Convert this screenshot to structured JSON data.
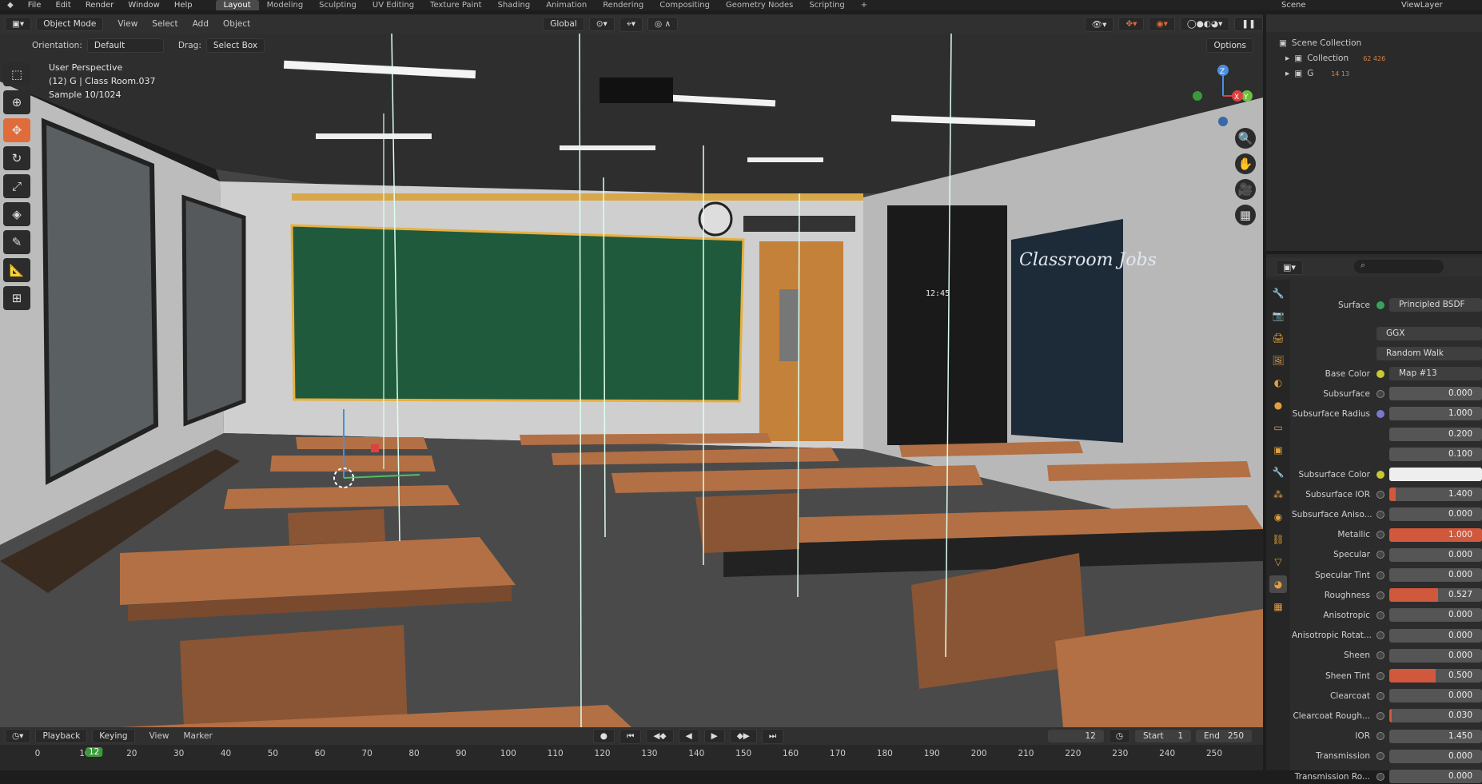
{
  "topbar": {
    "menus": [
      "File",
      "Edit",
      "Render",
      "Window",
      "Help"
    ],
    "workspaces": [
      "Layout",
      "Modeling",
      "Sculpting",
      "UV Editing",
      "Texture Paint",
      "Shading",
      "Animation",
      "Rendering",
      "Compositing",
      "Geometry Nodes",
      "Scripting"
    ],
    "active_workspace": "Layout",
    "scene_label": "Scene",
    "viewlayer_label": "ViewLayer"
  },
  "viewport_header": {
    "mode": "Object Mode",
    "menus": [
      "View",
      "Select",
      "Add",
      "Object"
    ],
    "transform": "Global",
    "orientation_label": "Orientation:",
    "orientation_value": "Default",
    "drag_label": "Drag:",
    "drag_value": "Select Box",
    "options": "Options"
  },
  "viewport_info": {
    "line1": "User Perspective",
    "line2": "(12) G | Class Room.037",
    "line3": "Sample 10/1024"
  },
  "scene_text": {
    "poster_title": "Classroom Jobs",
    "clock_digits": "12:45"
  },
  "outliner": {
    "root": "Scene Collection",
    "items": [
      {
        "name": "Collection",
        "badge": "62 426"
      },
      {
        "name": "G",
        "badge": "14 13"
      }
    ]
  },
  "properties": {
    "section": "Surface",
    "surface_label": "Surface",
    "surface_value": "Principled BSDF",
    "distribution": "GGX",
    "subsurface_method": "Random Walk",
    "rows": [
      {
        "label": "Base Color",
        "value": "Map #13",
        "type": "text",
        "socket": "yellow"
      },
      {
        "label": "Subsurface",
        "value": "0.000",
        "type": "num",
        "fill": 0
      },
      {
        "label": "Subsurface Radius",
        "value": "1.000",
        "type": "num",
        "fill": 0,
        "socket": "purple"
      },
      {
        "label": "",
        "value": "0.200",
        "type": "num",
        "fill": 0
      },
      {
        "label": "",
        "value": "0.100",
        "type": "num",
        "fill": 0
      },
      {
        "label": "Subsurface Color",
        "value": "",
        "type": "color",
        "socket": "yellow"
      },
      {
        "label": "Subsurface IOR",
        "value": "1.400",
        "type": "num",
        "fill": 0.07
      },
      {
        "label": "Subsurface Aniso...",
        "value": "0.000",
        "type": "num",
        "fill": 0
      },
      {
        "label": "Metallic",
        "value": "1.000",
        "type": "num",
        "fill": 1.0
      },
      {
        "label": "Specular",
        "value": "0.000",
        "type": "num",
        "fill": 0
      },
      {
        "label": "Specular Tint",
        "value": "0.000",
        "type": "num",
        "fill": 0
      },
      {
        "label": "Roughness",
        "value": "0.527",
        "type": "num",
        "fill": 0.527
      },
      {
        "label": "Anisotropic",
        "value": "0.000",
        "type": "num",
        "fill": 0
      },
      {
        "label": "Anisotropic Rotat...",
        "value": "0.000",
        "type": "num",
        "fill": 0
      },
      {
        "label": "Sheen",
        "value": "0.000",
        "type": "num",
        "fill": 0
      },
      {
        "label": "Sheen Tint",
        "value": "0.500",
        "type": "num",
        "fill": 0.5
      },
      {
        "label": "Clearcoat",
        "value": "0.000",
        "type": "num",
        "fill": 0
      },
      {
        "label": "Clearcoat Rough...",
        "value": "0.030",
        "type": "num",
        "fill": 0.03
      },
      {
        "label": "IOR",
        "value": "1.450",
        "type": "num",
        "fill": 0
      },
      {
        "label": "Transmission",
        "value": "0.000",
        "type": "num",
        "fill": 0
      },
      {
        "label": "Transmission Ro...",
        "value": "0.000",
        "type": "num",
        "fill": 0
      }
    ]
  },
  "timeline": {
    "menus": [
      "Playback",
      "Keying",
      "View",
      "Marker"
    ],
    "current_frame": "12",
    "start_label": "Start",
    "start_value": "1",
    "end_label": "End",
    "end_value": "250",
    "ticks": [
      "0",
      "10",
      "20",
      "30",
      "40",
      "50",
      "60",
      "70",
      "80",
      "90",
      "100",
      "110",
      "120",
      "130",
      "140",
      "150",
      "160",
      "170",
      "180",
      "190",
      "200",
      "210",
      "220",
      "230",
      "240",
      "250"
    ]
  },
  "colors": {
    "accent": "#e06c3c",
    "active_tool": "#e06c3c",
    "slider_fill": "#d0583c",
    "bg": "#1d1d1d"
  }
}
